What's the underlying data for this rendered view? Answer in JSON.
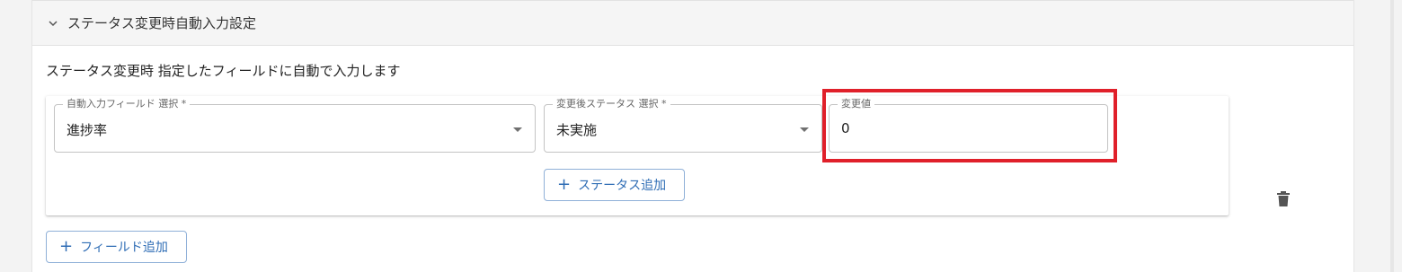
{
  "accordion": {
    "title": "ステータス変更時自動入力設定"
  },
  "description": "ステータス変更時 指定したフィールドに自動で入力します",
  "auto_field_select": {
    "label": "自動入力フィールド 選択 *",
    "value": "進捗率"
  },
  "status_select": {
    "label": "変更後ステータス 選択 *",
    "value": "未実施"
  },
  "change_value": {
    "label": "変更値",
    "value": "0"
  },
  "buttons": {
    "add_status": "ステータス追加",
    "add_field": "フィールド追加",
    "plus": "+"
  },
  "colors": {
    "accent": "#2f6db5",
    "highlight": "#e0202a"
  }
}
